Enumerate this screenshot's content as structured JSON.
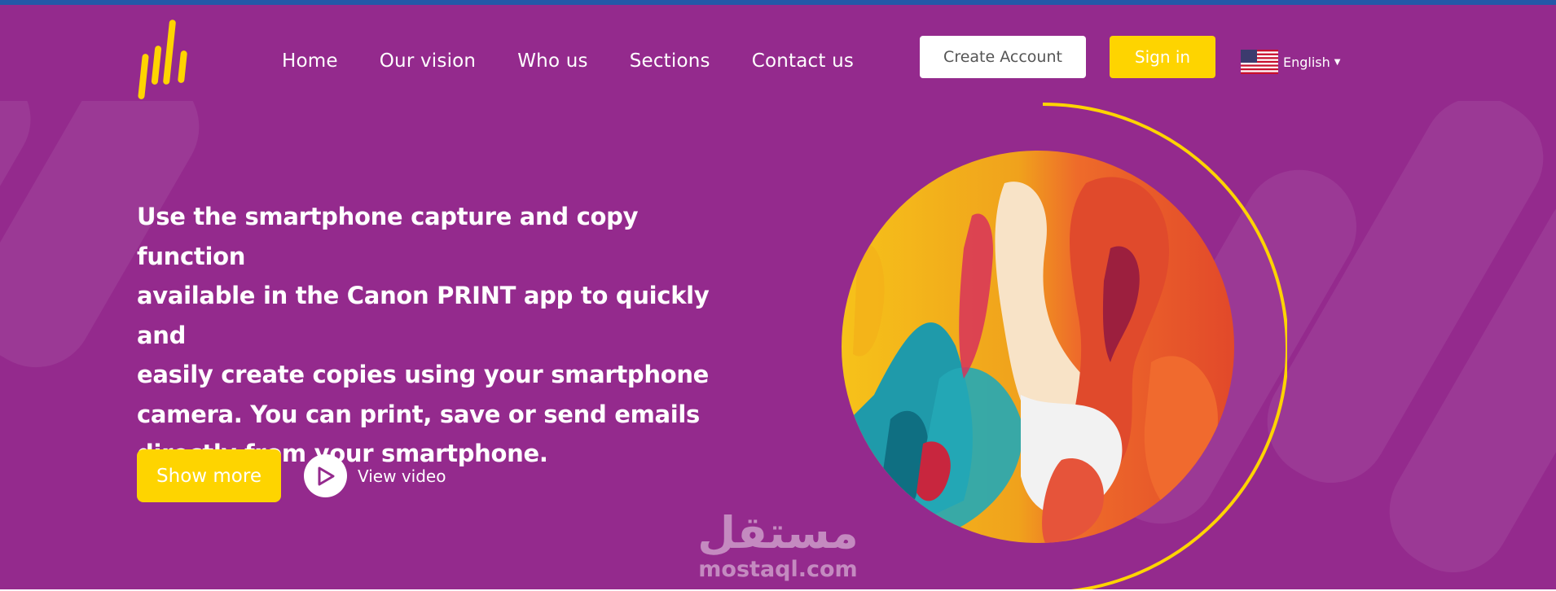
{
  "nav": {
    "items": [
      {
        "label": "Home"
      },
      {
        "label": "Our vision"
      },
      {
        "label": "Who us"
      },
      {
        "label": "Sections"
      },
      {
        "label": "Contact us"
      }
    ]
  },
  "header": {
    "create_account_label": "Create Account",
    "sign_in_label": "Sign in",
    "language_label": "English",
    "logo_icon": "bars-logo-icon",
    "flag_icon": "us-flag-icon"
  },
  "hero": {
    "headline_lines": [
      "Use the smartphone capture and copy function",
      "available in the Canon PRINT app to quickly and",
      "easily create copies using your smartphone",
      "camera. You can print, save or send emails",
      "directly from your smartphone."
    ],
    "show_more_label": "Show more",
    "view_video_label": "View video",
    "play_icon": "play-icon",
    "image": "abstract-painting-image"
  },
  "watermark": {
    "arabic": "مستقل",
    "latin": "mostaql.com"
  },
  "colors": {
    "brand_purple": "#942a8d",
    "accent_yellow": "#fed400",
    "top_strip": "#2358a8",
    "white": "#ffffff"
  }
}
